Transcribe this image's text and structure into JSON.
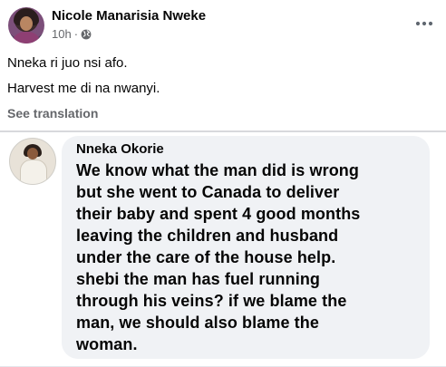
{
  "post": {
    "author_name": "Nicole Manarisia Nweke",
    "time": "10h",
    "separator": "·",
    "privacy_icon": "globe-icon",
    "more_icon": "more-horizontal-icon",
    "text_lines": [
      "Nneka ri juo nsi afo.",
      "Harvest me di na nwanyi."
    ],
    "see_translation": "See translation"
  },
  "embedded_comment": {
    "commenter_name": "Nneka Okorie",
    "text_lines": [
      "We know what the man did is wrong",
      "but she went to Canada to deliver",
      "their baby and spent 4 good months",
      "leaving the children and husband",
      "under the care of the house help.",
      "shebi the man has fuel running",
      "through his veins? if we blame the",
      "man, we should also blame the",
      "woman."
    ]
  },
  "colors": {
    "text_primary": "#050505",
    "text_secondary": "#65676b",
    "bubble_background": "#f0f2f5"
  }
}
